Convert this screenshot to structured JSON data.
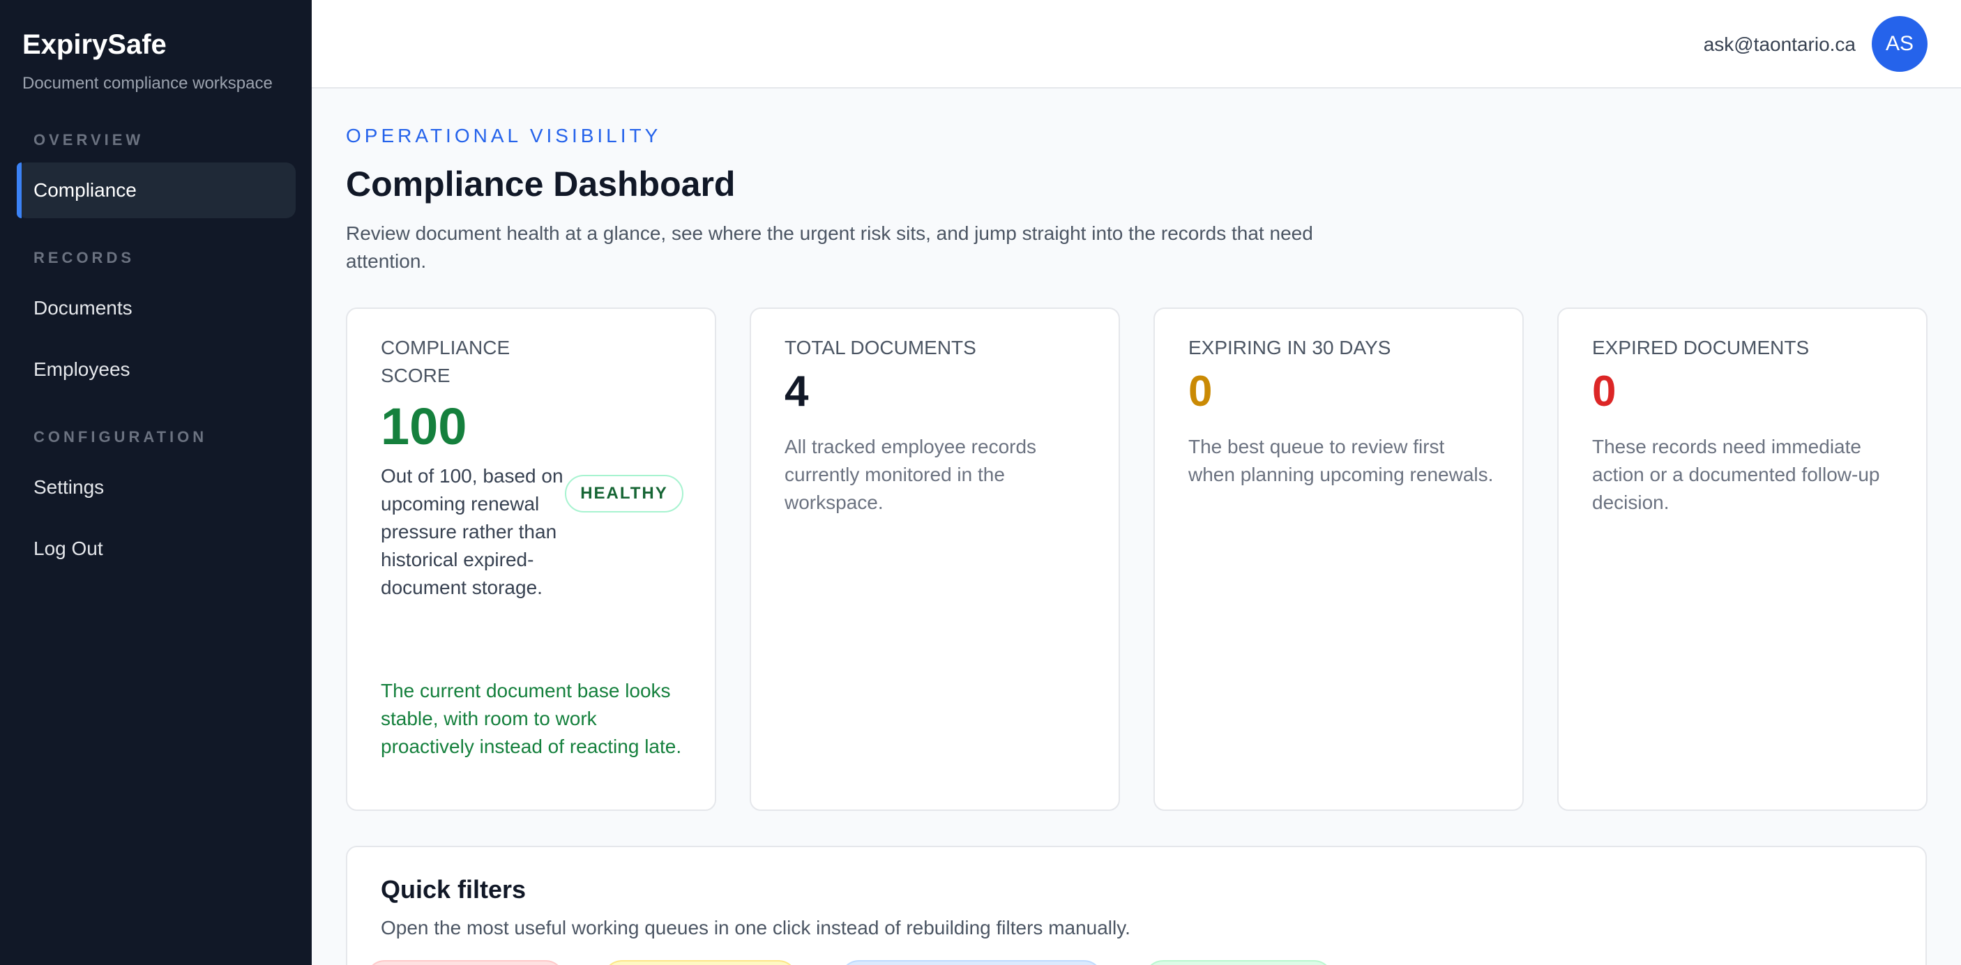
{
  "sidebar": {
    "brand": "ExpirySafe",
    "subtitle": "Document compliance workspace",
    "sections": {
      "overview": "OVERVIEW",
      "records": "RECORDS",
      "configuration": "CONFIGURATION"
    },
    "items": {
      "compliance": "Compliance",
      "documents": "Documents",
      "employees": "Employees",
      "settings": "Settings",
      "logout": "Log Out"
    }
  },
  "topbar": {
    "email": "ask@taontario.ca",
    "avatar_initials": "AS"
  },
  "main": {
    "eyebrow": "OPERATIONAL VISIBILITY",
    "title": "Compliance Dashboard",
    "description": "Review document health at a glance, see where the urgent risk sits, and jump straight into the records that need attention.",
    "cards": {
      "score": {
        "label": "COMPLIANCE SCORE",
        "value": "100",
        "description": "Out of 100, based on upcoming renewal pressure rather than historical expired-document storage.",
        "badge": "HEALTHY",
        "note": "The current document base looks stable, with room to work proactively instead of reacting late."
      },
      "total": {
        "label": "TOTAL DOCUMENTS",
        "value": "4",
        "description": "All tracked employee records currently monitored in the workspace."
      },
      "expiring": {
        "label": "EXPIRING IN 30 DAYS",
        "value": "0",
        "description": "The best queue to review first when planning upcoming renewals."
      },
      "expired": {
        "label": "EXPIRED DOCUMENTS",
        "value": "0",
        "description": "These records need immediate action or a documented follow-up decision."
      }
    },
    "quick_filters": {
      "title": "Quick filters",
      "description": "Open the most useful working queues in one click instead of rebuilding filters manually."
    }
  },
  "colors": {
    "accent": "#2563eb",
    "healthy": "#15803d",
    "warning": "#ca8a04",
    "danger": "#dc2626",
    "sidebar_bg": "#111827"
  }
}
